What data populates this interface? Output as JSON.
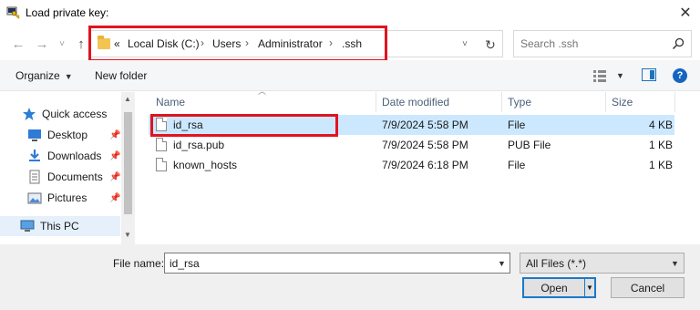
{
  "window": {
    "title": "Load private key:",
    "close_glyph": "✕"
  },
  "navigation": {
    "back_glyph": "←",
    "forward_glyph": "→",
    "recent_glyph": "˅",
    "up_glyph": "↑",
    "address": {
      "overflow": "«",
      "crumbs": [
        "Local Disk (C:)",
        "Users",
        "Administrator",
        ".ssh"
      ],
      "separator": "›"
    },
    "refresh_glyph": "↻",
    "search_placeholder": "Search .ssh"
  },
  "toolbar": {
    "organize": "Organize",
    "new_folder": "New folder",
    "help": "?"
  },
  "nav_pane": {
    "items": [
      {
        "label": "Quick access",
        "icon": "star-icon"
      },
      {
        "label": "Desktop",
        "icon": "desktop-icon",
        "pinned": true
      },
      {
        "label": "Downloads",
        "icon": "downloads-icon",
        "pinned": true
      },
      {
        "label": "Documents",
        "icon": "documents-icon",
        "pinned": true
      },
      {
        "label": "Pictures",
        "icon": "pictures-icon",
        "pinned": true
      },
      {
        "label": "This PC",
        "icon": "computer-icon",
        "selected": true
      }
    ]
  },
  "file_list": {
    "columns": [
      "Name",
      "Date modified",
      "Type",
      "Size"
    ],
    "rows": [
      {
        "name": "id_rsa",
        "date": "7/9/2024 5:58 PM",
        "type": "File",
        "size": "4 KB",
        "selected": true
      },
      {
        "name": "id_rsa.pub",
        "date": "7/9/2024 5:58 PM",
        "type": "PUB File",
        "size": "1 KB"
      },
      {
        "name": "known_hosts",
        "date": "7/9/2024 6:18 PM",
        "type": "File",
        "size": "1 KB"
      }
    ]
  },
  "bottom": {
    "file_name_label": "File name:",
    "file_name_value": "id_rsa",
    "filter_value": "All Files (*.*)",
    "open_label": "Open",
    "cancel_label": "Cancel"
  },
  "colors": {
    "highlight_box": "#e0141f",
    "selection": "#cce8ff",
    "accent": "#1979ca"
  }
}
